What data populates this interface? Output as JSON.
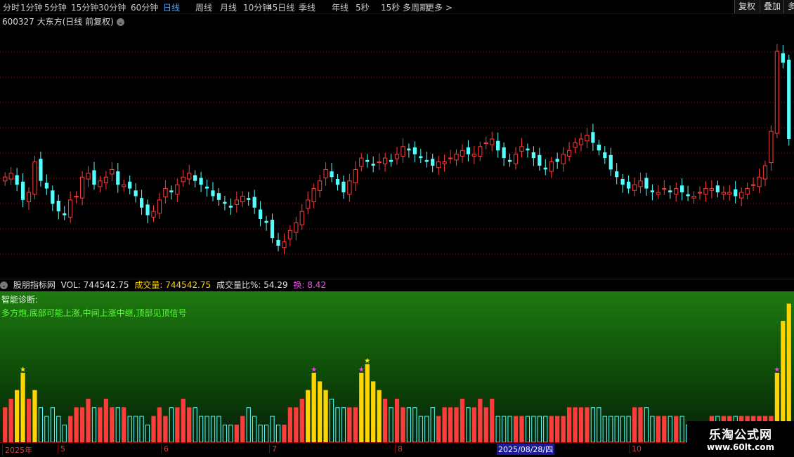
{
  "toolbar": {
    "tabs": [
      "分时",
      "1分钟",
      "5分钟",
      "15分钟",
      "30分钟",
      "60分钟",
      "日线",
      "周线",
      "月线",
      "10分钟",
      "45日线",
      "季线",
      "年线",
      "5秒",
      "15秒",
      "多周期",
      "更多 >"
    ],
    "active_tab": "日线",
    "right_buttons": [
      "复权",
      "叠加",
      "多"
    ]
  },
  "stock": {
    "title": "600327 大东方(日线 前复权)"
  },
  "indicator": {
    "name": "股朋指标网",
    "vol_label": "VOL:",
    "vol_value": "744542.75",
    "amount_label": "成交量:",
    "amount_value": "744542.75",
    "ratio_label": "成交量比%:",
    "ratio_value": "54.29",
    "turnover_label": "换:",
    "turnover_value": "8.42"
  },
  "diagnosis": {
    "title": "智能诊断:",
    "text": "多方炮,底部可能上涨,中间上涨中继,顶部见顶信号"
  },
  "date_axis": {
    "labels": [
      "2025年",
      "5",
      "6",
      "7",
      "8",
      "10"
    ],
    "highlight": "2025/08/28/四"
  },
  "logo": {
    "line1": "乐淘公式网",
    "line2": "www.60lt.com"
  },
  "colors": {
    "up": "#ff3c3c",
    "down": "#54ffff",
    "volume_up": "#ffd400",
    "background": "#000000",
    "grid": "#7a1a1a"
  },
  "chart_data": {
    "type": "candlestick",
    "price_close": [
      30,
      31,
      28,
      24,
      26,
      34,
      29,
      27,
      23,
      21,
      20,
      24,
      25,
      30,
      31,
      28,
      29,
      30,
      32,
      28,
      28,
      27,
      25,
      22,
      20,
      21,
      24,
      27,
      26,
      28,
      30,
      31,
      29,
      28,
      27,
      25,
      24,
      23,
      22,
      24,
      25,
      24,
      22,
      19,
      18,
      14,
      12,
      13,
      16,
      18,
      21,
      24,
      27,
      29,
      32,
      30,
      28,
      26,
      29,
      32,
      35,
      34,
      33,
      34,
      35,
      34,
      36,
      38,
      37,
      36,
      35,
      34,
      33,
      34,
      34,
      35,
      36,
      37,
      36,
      36,
      38,
      39,
      40,
      37,
      35,
      34,
      36,
      38,
      37,
      35,
      33,
      32,
      34,
      34,
      36,
      37,
      39,
      40,
      41,
      39,
      37,
      35,
      32,
      30,
      28,
      27,
      28,
      29,
      27,
      26,
      26,
      27,
      26,
      27,
      26,
      25,
      25,
      26,
      27,
      27,
      26,
      26,
      26,
      25,
      26,
      27,
      28,
      30,
      33,
      42,
      63,
      60,
      40
    ],
    "volume": [
      4,
      5,
      6,
      8,
      5,
      6,
      4,
      3,
      4,
      3,
      2,
      3,
      4,
      4,
      5,
      4,
      4,
      5,
      4,
      4,
      4,
      3,
      3,
      3,
      2,
      3,
      4,
      3,
      4,
      4,
      5,
      4,
      4,
      3,
      3,
      3,
      3,
      2,
      2,
      2,
      3,
      4,
      3,
      2,
      2,
      3,
      2,
      2,
      4,
      4,
      5,
      6,
      8,
      7,
      6,
      5,
      4,
      4,
      4,
      4,
      8,
      9,
      7,
      6,
      5,
      4,
      5,
      4,
      4,
      4,
      3,
      3,
      4,
      3,
      4,
      4,
      4,
      5,
      4,
      4,
      5,
      4,
      5,
      3,
      3,
      3,
      3,
      3,
      3,
      3,
      3,
      3,
      3,
      3,
      3,
      4,
      4,
      4,
      4,
      4,
      4,
      3,
      3,
      3,
      3,
      3,
      4,
      4,
      4,
      3,
      3,
      3,
      3,
      3,
      3,
      2,
      2,
      2,
      2,
      3,
      3,
      3,
      3,
      3,
      3,
      3,
      3,
      3,
      3,
      3,
      8,
      14,
      16
    ]
  }
}
